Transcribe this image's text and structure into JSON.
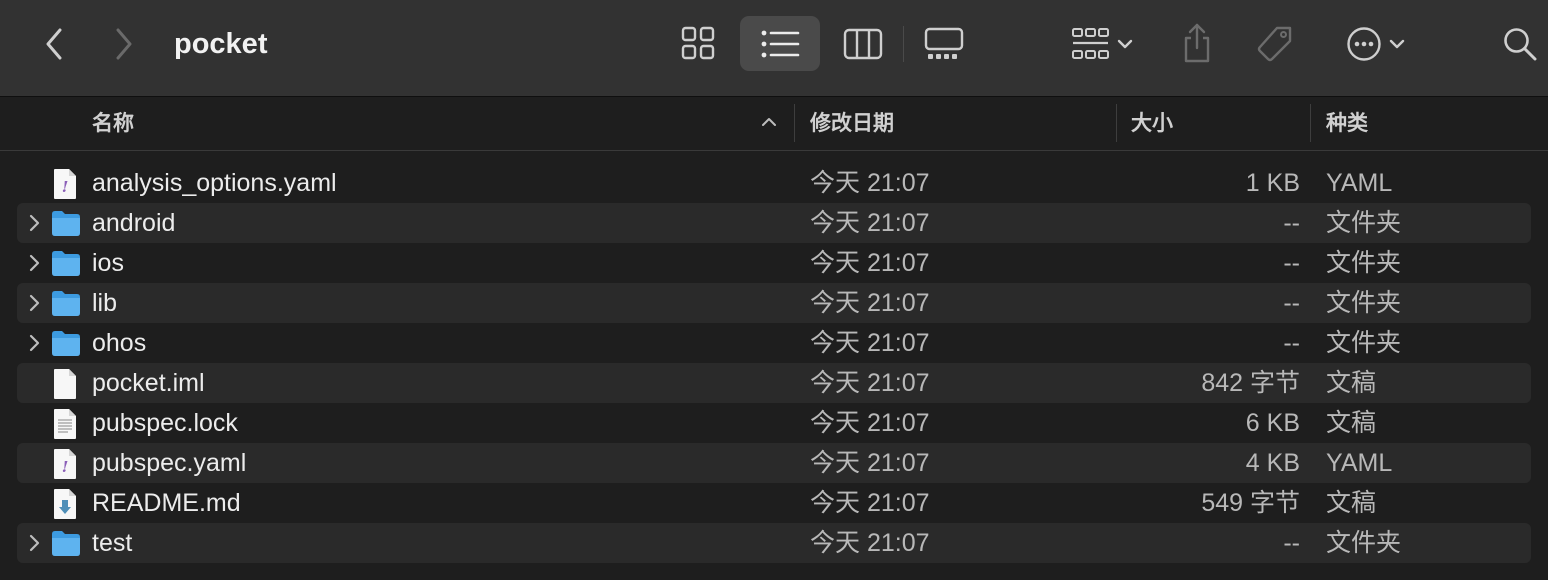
{
  "window": {
    "title": "pocket"
  },
  "toolbar": {
    "back_icon": "chevron-left-icon",
    "forward_icon": "chevron-right-icon",
    "views": [
      "icon-view",
      "list-view",
      "column-view",
      "gallery-view"
    ],
    "active_view": "list-view"
  },
  "columns": {
    "name": "名称",
    "modified": "修改日期",
    "size": "大小",
    "kind": "种类"
  },
  "files": [
    {
      "name": "analysis_options.yaml",
      "modified": "今天 21:07",
      "size": "1 KB",
      "kind": "YAML",
      "type": "yaml",
      "folder": false
    },
    {
      "name": "android",
      "modified": "今天 21:07",
      "size": "--",
      "kind": "文件夹",
      "type": "folder",
      "folder": true
    },
    {
      "name": "ios",
      "modified": "今天 21:07",
      "size": "--",
      "kind": "文件夹",
      "type": "folder",
      "folder": true
    },
    {
      "name": "lib",
      "modified": "今天 21:07",
      "size": "--",
      "kind": "文件夹",
      "type": "folder",
      "folder": true
    },
    {
      "name": "ohos",
      "modified": "今天 21:07",
      "size": "--",
      "kind": "文件夹",
      "type": "folder",
      "folder": true
    },
    {
      "name": "pocket.iml",
      "modified": "今天 21:07",
      "size": "842 字节",
      "kind": "文稿",
      "type": "blank",
      "folder": false
    },
    {
      "name": "pubspec.lock",
      "modified": "今天 21:07",
      "size": "6 KB",
      "kind": "文稿",
      "type": "text",
      "folder": false
    },
    {
      "name": "pubspec.yaml",
      "modified": "今天 21:07",
      "size": "4 KB",
      "kind": "YAML",
      "type": "yaml",
      "folder": false
    },
    {
      "name": "README.md",
      "modified": "今天 21:07",
      "size": "549 字节",
      "kind": "文稿",
      "type": "markdown",
      "folder": false
    },
    {
      "name": "test",
      "modified": "今天 21:07",
      "size": "--",
      "kind": "文件夹",
      "type": "folder",
      "folder": true
    }
  ],
  "colors": {
    "folder_blue": "#5eb3ef",
    "folder_blue_dark": "#3d9be0",
    "background": "#1e1e1e",
    "toolbar": "#323232"
  }
}
